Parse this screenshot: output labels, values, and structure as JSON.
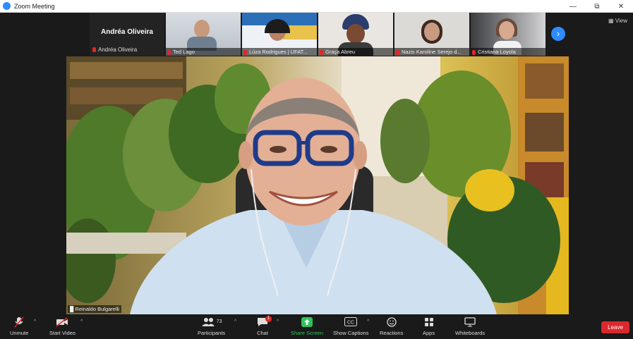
{
  "window": {
    "title": "Zoom Meeting"
  },
  "gallery": {
    "active_speaker_tile": {
      "name_big": "Andréa Oliveira",
      "name_small": "Andréa Oliveira"
    },
    "thumbnails": [
      {
        "name": "Ted Lago"
      },
      {
        "name": "Lúza Rodrigues | UFAT..."
      },
      {
        "name": "Graça Abreu"
      },
      {
        "name": "Nazis Karoline Serejo d..."
      },
      {
        "name": "Cristiana Loyola"
      }
    ],
    "view_label": "View"
  },
  "speaker": {
    "name": "Reinaldo Bulgarelli"
  },
  "toolbar": {
    "unmute": "Unmute",
    "start_video": "Start Video",
    "participants": "Participants",
    "participants_count": "73",
    "chat": "Chat",
    "chat_badge": "1",
    "share_screen": "Share Screen",
    "show_captions": "Show Captions",
    "reactions": "Reactions",
    "apps": "Apps",
    "whiteboards": "Whiteboards",
    "leave": "Leave"
  },
  "colors": {
    "accent_blue": "#2d8cff",
    "share_green": "#2ec25a",
    "leave_red": "#d9292e"
  }
}
